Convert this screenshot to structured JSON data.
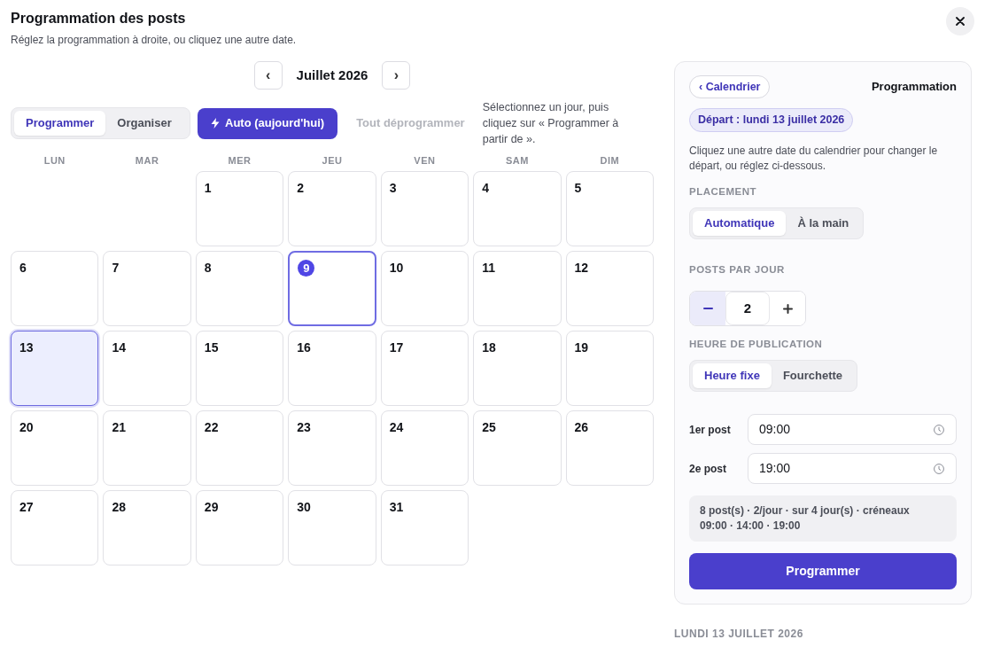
{
  "dialog": {
    "title": "Programmation des posts",
    "subtitle": "Réglez la programmation à droite, ou cliquez une autre date."
  },
  "calendar": {
    "prev": "‹",
    "month": "Juillet 2026",
    "next": "›",
    "modes": [
      {
        "label": "Programmer",
        "selected": true
      },
      {
        "label": "Organiser",
        "selected": false
      }
    ],
    "auto_button": "Auto (aujourd'hui)",
    "unschedule_button": {
      "label": "Tout déprogrammer",
      "disabled": true
    },
    "hint": "Sélectionnez un jour, puis cliquez sur « Programmer à partir de ».",
    "weekdays": [
      "LUN",
      "MAR",
      "MER",
      "JEU",
      "VEN",
      "SAM",
      "DIM"
    ],
    "cells": [
      {
        "kind": "blank"
      },
      {
        "kind": "blank"
      },
      {
        "kind": "day",
        "label": "1",
        "today": false,
        "selected": false
      },
      {
        "kind": "day",
        "label": "2",
        "today": false,
        "selected": false
      },
      {
        "kind": "day",
        "label": "3",
        "today": false,
        "selected": false
      },
      {
        "kind": "day",
        "label": "4",
        "today": false,
        "selected": false
      },
      {
        "kind": "day",
        "label": "5",
        "today": false,
        "selected": false
      },
      {
        "kind": "day",
        "label": "6",
        "today": false,
        "selected": false
      },
      {
        "kind": "day",
        "label": "7",
        "today": false,
        "selected": false
      },
      {
        "kind": "day",
        "label": "8",
        "today": false,
        "selected": false
      },
      {
        "kind": "day",
        "label": "9",
        "today": true,
        "selected": false
      },
      {
        "kind": "day",
        "label": "10",
        "today": false,
        "selected": false
      },
      {
        "kind": "day",
        "label": "11",
        "today": false,
        "selected": false
      },
      {
        "kind": "day",
        "label": "12",
        "today": false,
        "selected": false
      },
      {
        "kind": "day",
        "label": "13",
        "today": false,
        "selected": true
      },
      {
        "kind": "day",
        "label": "14",
        "today": false,
        "selected": false
      },
      {
        "kind": "day",
        "label": "15",
        "today": false,
        "selected": false
      },
      {
        "kind": "day",
        "label": "16",
        "today": false,
        "selected": false
      },
      {
        "kind": "day",
        "label": "17",
        "today": false,
        "selected": false
      },
      {
        "kind": "day",
        "label": "18",
        "today": false,
        "selected": false
      },
      {
        "kind": "day",
        "label": "19",
        "today": false,
        "selected": false
      },
      {
        "kind": "day",
        "label": "20",
        "today": false,
        "selected": false
      },
      {
        "kind": "day",
        "label": "21",
        "today": false,
        "selected": false
      },
      {
        "kind": "day",
        "label": "22",
        "today": false,
        "selected": false
      },
      {
        "kind": "day",
        "label": "23",
        "today": false,
        "selected": false
      },
      {
        "kind": "day",
        "label": "24",
        "today": false,
        "selected": false
      },
      {
        "kind": "day",
        "label": "25",
        "today": false,
        "selected": false
      },
      {
        "kind": "day",
        "label": "26",
        "today": false,
        "selected": false
      },
      {
        "kind": "day",
        "label": "27",
        "today": false,
        "selected": false
      },
      {
        "kind": "day",
        "label": "28",
        "today": false,
        "selected": false
      },
      {
        "kind": "day",
        "label": "29",
        "today": false,
        "selected": false
      },
      {
        "kind": "day",
        "label": "30",
        "today": false,
        "selected": false
      },
      {
        "kind": "day",
        "label": "31",
        "today": false,
        "selected": false
      }
    ]
  },
  "panel": {
    "back_button": "‹ Calendrier",
    "title": "Programmation",
    "start_badge": "Départ : lundi 13 juillet 2026",
    "description": "Cliquez une autre date du calendrier pour changer le départ, ou réglez ci-dessous.",
    "placement": {
      "label": "PLACEMENT",
      "options": [
        {
          "label": "Automatique",
          "selected": true
        },
        {
          "label": "À la main",
          "selected": false
        }
      ]
    },
    "posts_per_day": {
      "label": "POSTS PAR JOUR",
      "value": "2"
    },
    "publish_time": {
      "label": "HEURE DE PUBLICATION",
      "options": [
        {
          "label": "Heure fixe",
          "selected": true
        },
        {
          "label": "Fourchette",
          "selected": false
        }
      ]
    },
    "slots": [
      {
        "label": "1er post",
        "value": "09:00"
      },
      {
        "label": "2e post",
        "value": "19:00"
      }
    ],
    "summary": "8 post(s) · 2/jour · sur 4 jour(s) · créneaux 09:00 · 14:00 · 19:00",
    "submit_button": "Programmer"
  },
  "day_heading": "LUNDI 13 JUILLET 2026"
}
